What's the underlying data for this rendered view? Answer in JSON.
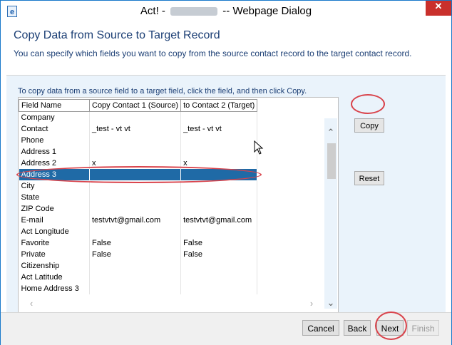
{
  "window": {
    "title_prefix": "Act! -",
    "title_suffix": "-- Webpage Dialog",
    "close_glyph": "✕",
    "app_icon": "e"
  },
  "header": {
    "title": "Copy Data from Source to Target Record",
    "description": "You can specify which fields you want to copy from the source contact record to the target contact record."
  },
  "instructions": "To copy data from a source field to a target field, click the field, and then click Copy.",
  "grid": {
    "columns": [
      "Field Name",
      "Copy Contact 1 (Source)",
      "to Contact 2 (Target)"
    ],
    "rows": [
      {
        "field": "Company",
        "source": "",
        "target": ""
      },
      {
        "field": "Contact",
        "source": "_test - vt vt",
        "target": "_test - vt vt"
      },
      {
        "field": "Phone",
        "source": "",
        "target": ""
      },
      {
        "field": "Address 1",
        "source": "",
        "target": ""
      },
      {
        "field": "Address 2",
        "source": "x",
        "target": "x"
      },
      {
        "field": "Address 3",
        "source": "",
        "target": ""
      },
      {
        "field": "City",
        "source": "",
        "target": ""
      },
      {
        "field": "State",
        "source": "",
        "target": ""
      },
      {
        "field": "ZIP Code",
        "source": "",
        "target": ""
      },
      {
        "field": "E-mail",
        "source": "testvtvt@gmail.com",
        "target": "testvtvt@gmail.com"
      },
      {
        "field": "Act Longitude",
        "source": "",
        "target": ""
      },
      {
        "field": "Favorite",
        "source": "False",
        "target": "False"
      },
      {
        "field": "Private",
        "source": "False",
        "target": "False"
      },
      {
        "field": "Citizenship",
        "source": "",
        "target": ""
      },
      {
        "field": "Act Latitude",
        "source": "",
        "target": ""
      },
      {
        "field": "Home Address 3",
        "source": "",
        "target": ""
      }
    ],
    "selected_field": "Address 3"
  },
  "side_buttons": {
    "copy": "Copy",
    "reset": "Reset"
  },
  "footer": {
    "cancel": "Cancel",
    "back": "Back",
    "next": "Next",
    "finish": "Finish"
  },
  "scroll_glyphs": {
    "up": "⌃",
    "down": "⌄",
    "left": "‹",
    "right": "›"
  },
  "colors": {
    "selected_row": "#1f6aa6",
    "annotation": "#d9434b",
    "heading_text": "#1b3e74",
    "close_button": "#c9302c"
  }
}
